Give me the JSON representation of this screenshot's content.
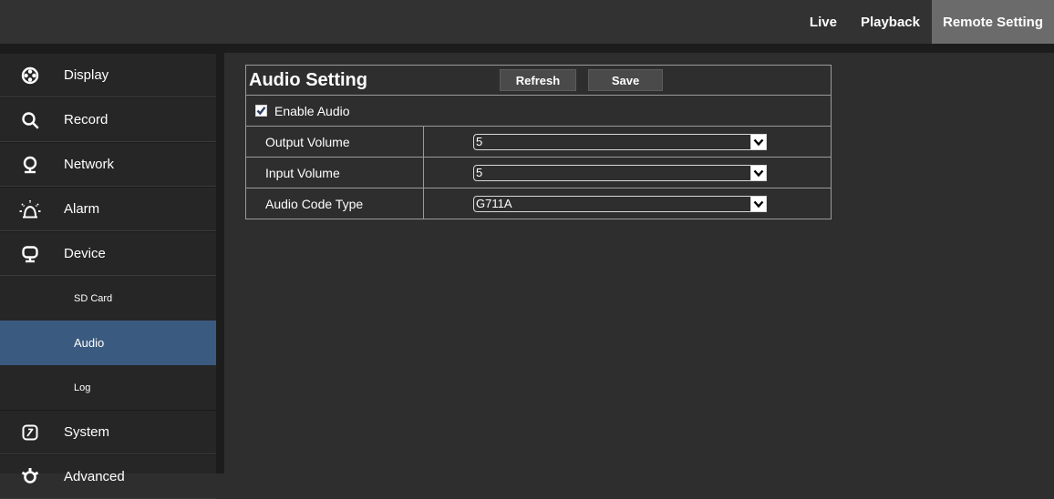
{
  "topnav": {
    "live": "Live",
    "playback": "Playback",
    "remote_setting": "Remote Setting"
  },
  "sidebar": {
    "items": [
      {
        "label": "Display",
        "icon": "display-icon"
      },
      {
        "label": "Record",
        "icon": "search-icon"
      },
      {
        "label": "Network",
        "icon": "network-icon"
      },
      {
        "label": "Alarm",
        "icon": "alarm-icon"
      },
      {
        "label": "Device",
        "icon": "device-icon"
      },
      {
        "label": "System",
        "icon": "system-icon"
      },
      {
        "label": "Advanced",
        "icon": "gear-icon"
      }
    ],
    "subitems": [
      {
        "label": "SD Card"
      },
      {
        "label": "Audio"
      },
      {
        "label": "Log"
      }
    ]
  },
  "panel": {
    "title": "Audio Setting",
    "refresh_label": "Refresh",
    "save_label": "Save",
    "enable_audio": {
      "label": "Enable Audio",
      "checked": true
    },
    "rows": [
      {
        "label": "Output Volume",
        "value": "5"
      },
      {
        "label": "Input Volume",
        "value": "5"
      },
      {
        "label": "Audio Code Type",
        "value": "G711A"
      }
    ]
  },
  "colors": {
    "background": "#2e2e2e",
    "sidebar": "#262626",
    "active_nav": "#6b6b6b",
    "active_subitem": "#3b5a80"
  }
}
